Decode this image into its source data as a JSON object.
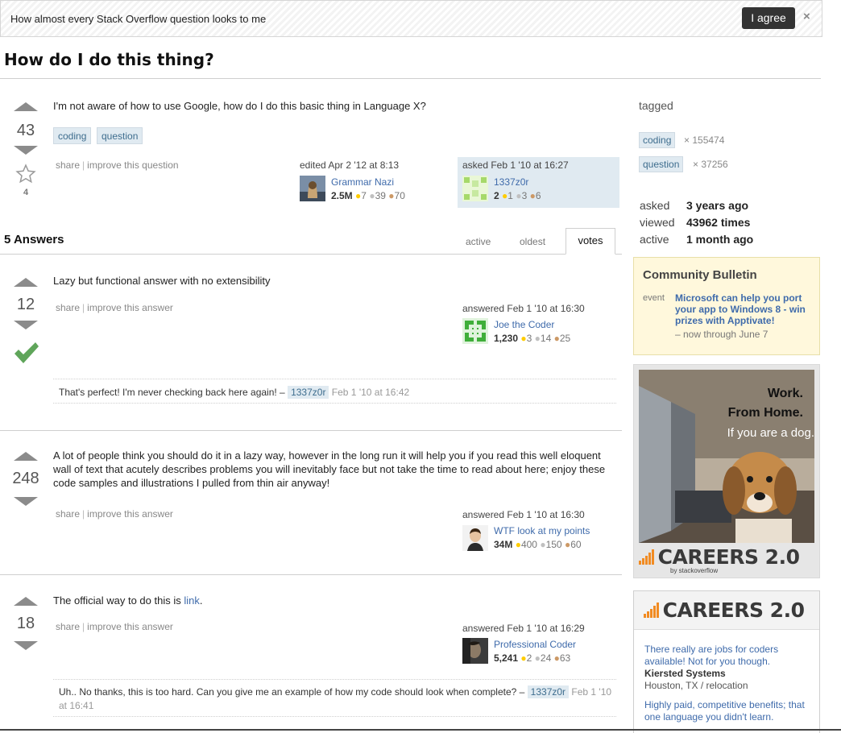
{
  "notification": {
    "text": "How almost every Stack Overflow question looks to me",
    "agree_label": "I agree",
    "close_label": "×"
  },
  "question": {
    "title": "How do I do this thing?",
    "votes": "43",
    "favorites": "4",
    "body": "I'm not aware of how to use Google, how do I do this basic thing in Language X?",
    "tags": [
      "coding",
      "question"
    ],
    "menu": {
      "share": "share",
      "improve": "improve this question",
      "sep": "|"
    },
    "edited": {
      "action": "edited Apr 2 '12 at 8:13",
      "user": "Grammar Nazi",
      "rep": "2.5M",
      "gold": "7",
      "silver": "39",
      "bronze": "70"
    },
    "asked": {
      "action": "asked Feb 1 '10 at 16:27",
      "user": "1337z0r",
      "rep": "2",
      "gold": "1",
      "silver": "3",
      "bronze": "6"
    }
  },
  "answers_header": {
    "count_label": "5 Answers",
    "tabs": [
      "active",
      "oldest",
      "votes"
    ],
    "active_tab": "votes"
  },
  "answers": [
    {
      "votes": "12",
      "body": "Lazy but functional answer with no extensibility",
      "menu": {
        "share": "share",
        "improve": "improve this answer"
      },
      "sig": {
        "action": "answered Feb 1 '10 at 16:30",
        "user": "Joe the Coder",
        "rep": "1,230",
        "gold": "3",
        "silver": "14",
        "bronze": "25"
      },
      "comment": {
        "text": "That's perfect! I'm never checking back here again! –",
        "user": "1337z0r",
        "date": "Feb 1 '10 at 16:42"
      }
    },
    {
      "votes": "248",
      "body": "A lot of people think you should do it in a lazy way, however in the long run it will help you if you read this well eloquent wall of text that acutely describes problems you will inevitably face but not take the time to read about here; enjoy these code samples and illustrations I pulled from thin air anyway!",
      "menu": {
        "share": "share",
        "improve": "improve this answer"
      },
      "sig": {
        "action": "answered Feb 1 '10 at 16:30",
        "user": "WTF look at my points",
        "rep": "34M",
        "gold": "400",
        "silver": "150",
        "bronze": "60"
      }
    },
    {
      "votes": "18",
      "body_prefix": "The official way to do this is ",
      "body_link": "link",
      "body_suffix": ".",
      "menu": {
        "share": "share",
        "improve": "improve this answer"
      },
      "sig": {
        "action": "answered Feb 1 '10 at 16:29",
        "user": "Professional Coder",
        "rep": "5,241",
        "gold": "2",
        "silver": "24",
        "bronze": "63"
      },
      "comment": {
        "text": "Uh.. No thanks, this is too hard. Can you give me an example of how my code should look when complete? –",
        "user": "1337z0r",
        "date": "Feb 1 '10 at 16:41"
      }
    }
  ],
  "sidebar": {
    "tagged_label": "tagged",
    "tags": [
      {
        "name": "coding",
        "count": "× 155474"
      },
      {
        "name": "question",
        "count": "× 37256"
      }
    ],
    "stats": [
      {
        "label": "asked",
        "value": "3 years ago"
      },
      {
        "label": "viewed",
        "value": "43962 times"
      },
      {
        "label": "active",
        "value": "1 month ago"
      }
    ],
    "bulletin": {
      "title": "Community Bulletin",
      "kind": "event",
      "link": "Microsoft can help you port your app to Windows 8 - win prizes with Apptivate!",
      "sub": "– now through June 7"
    },
    "ad1": {
      "line1": "Work.",
      "line2": "From Home.",
      "line3": "If you are a dog.",
      "brand": "CAREERS 2.0",
      "by": "by stackoverflow"
    },
    "ad2": {
      "brand": "CAREERS 2.0",
      "text1": "There really are jobs for coders available! Not for you though.",
      "company": "Kiersted Systems",
      "location": "Houston, TX / relocation",
      "text2": "Highly paid, competitive benefits; that one language you didn't learn."
    }
  }
}
